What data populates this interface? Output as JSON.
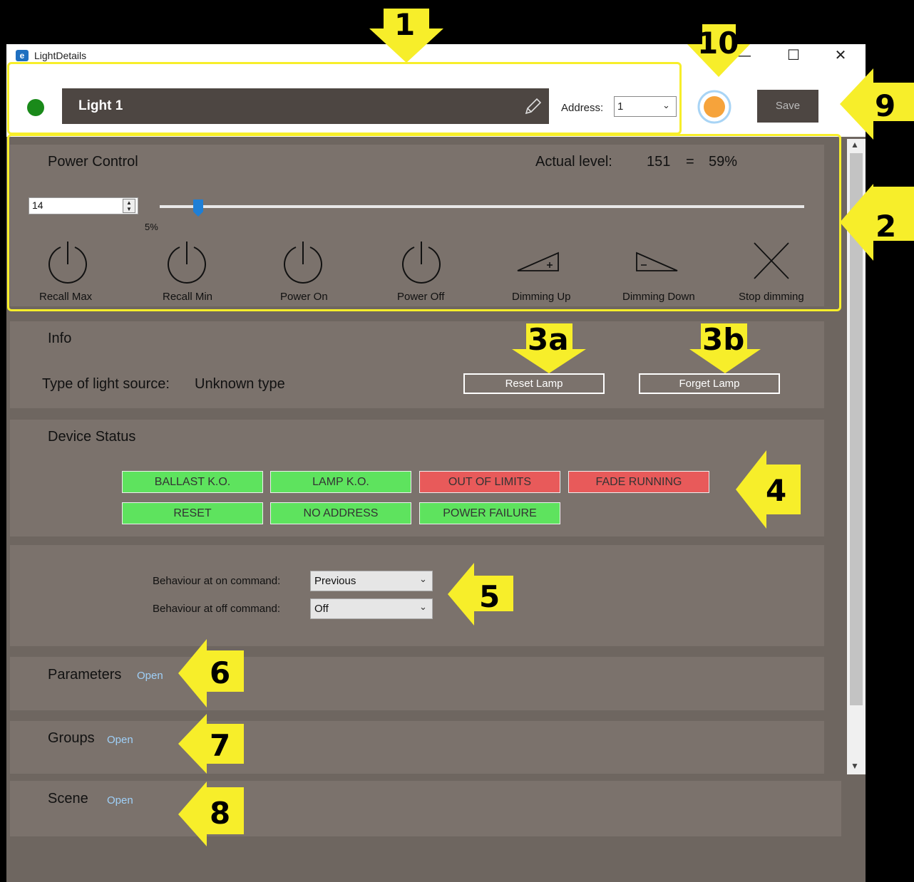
{
  "window": {
    "title": "LightDetails",
    "minimize": "—",
    "maximize": "☐",
    "close": "✕"
  },
  "header": {
    "light_name": "Light 1",
    "address_label": "Address:",
    "address_value": "1",
    "save_label": "Save"
  },
  "power_control": {
    "title": "Power Control",
    "actual_level_label": "Actual level:",
    "actual_level_value": "151",
    "equals": "=",
    "actual_level_percent": "59%",
    "level_input": "14",
    "slider_min_percent": "5%",
    "slider_fraction": 0.06,
    "buttons": [
      {
        "label": "Recall Max"
      },
      {
        "label": "Recall Min"
      },
      {
        "label": "Power On"
      },
      {
        "label": "Power Off"
      },
      {
        "label": "Dimming Up"
      },
      {
        "label": "Dimming Down"
      },
      {
        "label": "Stop dimming"
      }
    ]
  },
  "info": {
    "title": "Info",
    "type_label": "Type of light source:",
    "type_value": "Unknown type",
    "reset_label": "Reset Lamp",
    "forget_label": "Forget Lamp"
  },
  "device_status": {
    "title": "Device Status",
    "items": [
      {
        "label": "BALLAST K.O.",
        "state": "ok"
      },
      {
        "label": "LAMP K.O.",
        "state": "ok"
      },
      {
        "label": "OUT OF LIMITS",
        "state": "bad"
      },
      {
        "label": "FADE RUNNING",
        "state": "bad"
      },
      {
        "label": "RESET",
        "state": "ok"
      },
      {
        "label": "NO ADDRESS",
        "state": "ok"
      },
      {
        "label": "POWER FAILURE",
        "state": "ok"
      }
    ]
  },
  "behaviour": {
    "on_label": "Behaviour at on command:",
    "on_value": "Previous",
    "off_label": "Behaviour at off command:",
    "off_value": "Off"
  },
  "sections": {
    "parameters": {
      "title": "Parameters",
      "link": "Open"
    },
    "groups": {
      "title": "Groups",
      "link": "Open"
    },
    "scene": {
      "title": "Scene",
      "link": "Open"
    }
  },
  "annotations": [
    "1",
    "2",
    "3a",
    "3b",
    "4",
    "5",
    "6",
    "7",
    "8",
    "9",
    "10"
  ],
  "colors": {
    "status_ok": "#5ee35e",
    "status_bad": "#e85a5a",
    "status_dot": "#1a8a1a",
    "annotation": "#f7ee2a"
  }
}
